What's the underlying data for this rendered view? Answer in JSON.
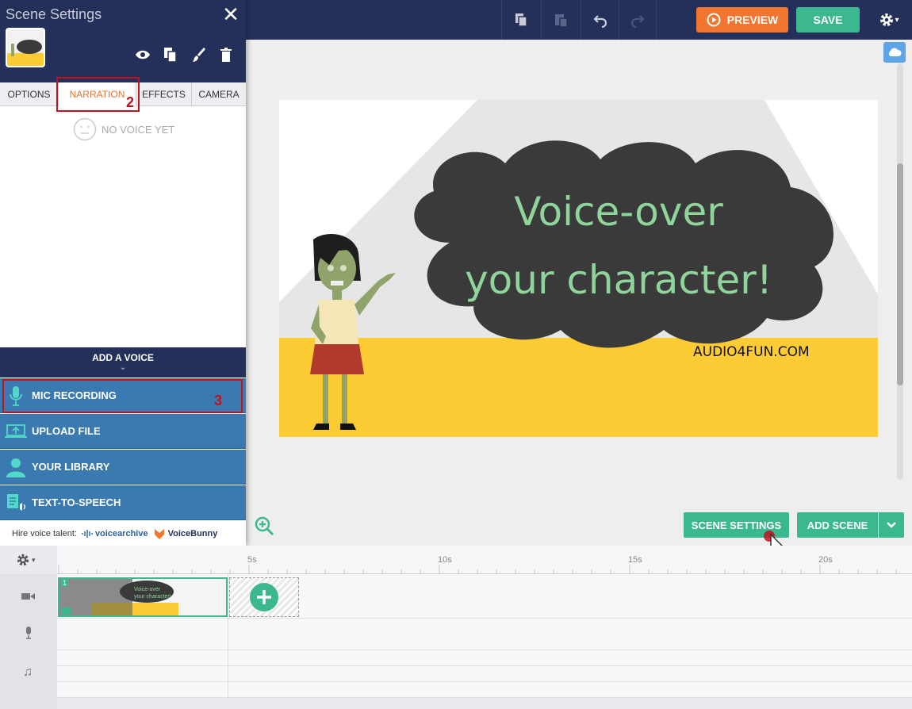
{
  "toolbar": {
    "preview_label": "PREVIEW",
    "save_label": "SAVE"
  },
  "panel": {
    "title": "Scene Settings",
    "tabs": [
      {
        "label": "OPTIONS"
      },
      {
        "label": "NARRATION"
      },
      {
        "label": "EFFECTS"
      },
      {
        "label": "CAMERA"
      }
    ],
    "no_voice_label": "NO VOICE YET",
    "add_voice_label": "ADD A VOICE",
    "voice_options": [
      {
        "label": "MIC RECORDING",
        "icon": "microphone-icon"
      },
      {
        "label": "UPLOAD FILE",
        "icon": "upload-laptop-icon"
      },
      {
        "label": "YOUR LIBRARY",
        "icon": "user-library-icon"
      },
      {
        "label": "TEXT-TO-SPEECH",
        "icon": "text-to-speech-icon"
      }
    ],
    "hire_label": "Hire voice talent:",
    "hire_links": [
      "voicearchive",
      "VoiceBunny"
    ]
  },
  "stage": {
    "headline_line1": "Voice-over",
    "headline_line2": "your character!",
    "website": "AUDIO4FUN.COM"
  },
  "actions": {
    "scene_settings_label": "SCENE SETTINGS",
    "add_scene_label": "ADD SCENE"
  },
  "timeline": {
    "ticks": [
      "5s",
      "10s",
      "15s",
      "20s"
    ],
    "clip_number": "1",
    "clip_text_line1": "Voice-over",
    "clip_text_line2": "your character!"
  },
  "annotations": [
    "1",
    "2",
    "3"
  ],
  "colors": {
    "topbar": "#24305a",
    "accent_green": "#3cb891",
    "accent_orange": "#f27630",
    "voice_blue": "#3a7ab0",
    "annotation_red": "#c0121f",
    "stage_yellow": "#fdcc34",
    "cloud": "#3a3a3a",
    "text_green": "#8fd49a"
  }
}
